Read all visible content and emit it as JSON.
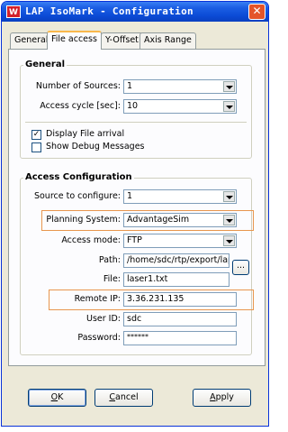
{
  "window": {
    "app_icon_text": "W",
    "title": "LAP IsoMark - Configuration",
    "close_symbol": "✕"
  },
  "tabs": [
    {
      "label": "General",
      "active": false
    },
    {
      "label": "File access",
      "active": true
    },
    {
      "label": "Y-Offset",
      "active": false
    },
    {
      "label": "Axis Range",
      "active": false
    }
  ],
  "general": {
    "title": "General",
    "num_sources_label": "Number of Sources:",
    "num_sources_value": "1",
    "access_cycle_label": "Access cycle [sec]:",
    "access_cycle_value": "10",
    "display_file_arrival_label": "Display File arrival",
    "display_file_arrival_checked": true,
    "show_debug_label": "Show Debug Messages",
    "show_debug_checked": false
  },
  "access": {
    "title": "Access Configuration",
    "source_label": "Source to configure:",
    "source_value": "1",
    "planning_label": "Planning System:",
    "planning_value": "AdvantageSim",
    "mode_label": "Access mode:",
    "mode_value": "FTP",
    "path_label": "Path:",
    "path_value": "/home/sdc/rtp/export/lap/",
    "browse_label": "...",
    "file_label": "File:",
    "file_value": "laser1.txt",
    "remote_ip_label": "Remote IP:",
    "remote_ip_value": "3.36.231.135",
    "user_id_label": "User ID:",
    "user_id_value": "sdc",
    "password_label": "Password:",
    "password_value": "******"
  },
  "buttons": {
    "ok_u": "O",
    "ok_rest": "K",
    "cancel_u": "C",
    "cancel_rest": "ancel",
    "apply_u": "A",
    "apply_rest": "pply"
  },
  "colors": {
    "title_bar": "#0b4bd6",
    "dialog_bg": "#ece9d8",
    "highlight": "#e8964e"
  }
}
